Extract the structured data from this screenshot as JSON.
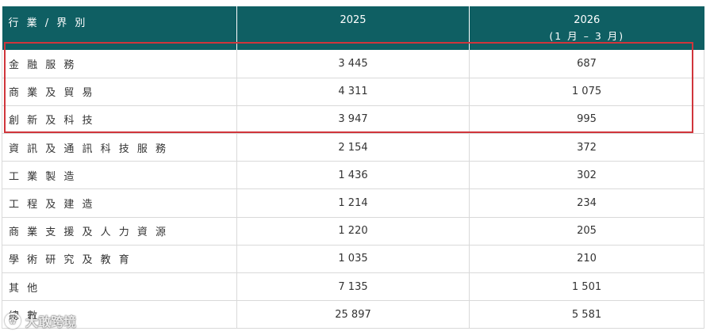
{
  "table": {
    "headers": {
      "col1": "行 業 / 界 別",
      "col2": "2025",
      "col3_year": "2026",
      "col3_sub": "(1 月 – 3 月)"
    },
    "rows": [
      {
        "sector": "金 融 服 務",
        "y2025": "3 445",
        "y2026": "687"
      },
      {
        "sector": "商 業 及 貿 易",
        "y2025": "4 311",
        "y2026": "1 075"
      },
      {
        "sector": "創 新 及 科 技",
        "y2025": "3 947",
        "y2026": "995"
      },
      {
        "sector": "資 訊 及 通 訊 科 技 服 務",
        "y2025": "2 154",
        "y2026": "372"
      },
      {
        "sector": "工 業 製 造",
        "y2025": "1 436",
        "y2026": "302"
      },
      {
        "sector": "工 程 及 建 造",
        "y2025": "1 214",
        "y2026": "234"
      },
      {
        "sector": "商 業 支 援 及 人 力 資 源",
        "y2025": "1 220",
        "y2026": "205"
      },
      {
        "sector": "學 術 研 究 及 教 育",
        "y2025": "1 035",
        "y2026": "210"
      },
      {
        "sector": "其 他",
        "y2025": "7 135",
        "y2026": "1 501"
      },
      {
        "sector": "總 數",
        "y2025": "25 897",
        "y2026": "5 581"
      }
    ]
  },
  "watermark": {
    "icon_glyph": "✿",
    "text": "大敢跨境"
  },
  "colors": {
    "header_bg": "#0f5f63",
    "highlight_border": "#d0353b"
  }
}
